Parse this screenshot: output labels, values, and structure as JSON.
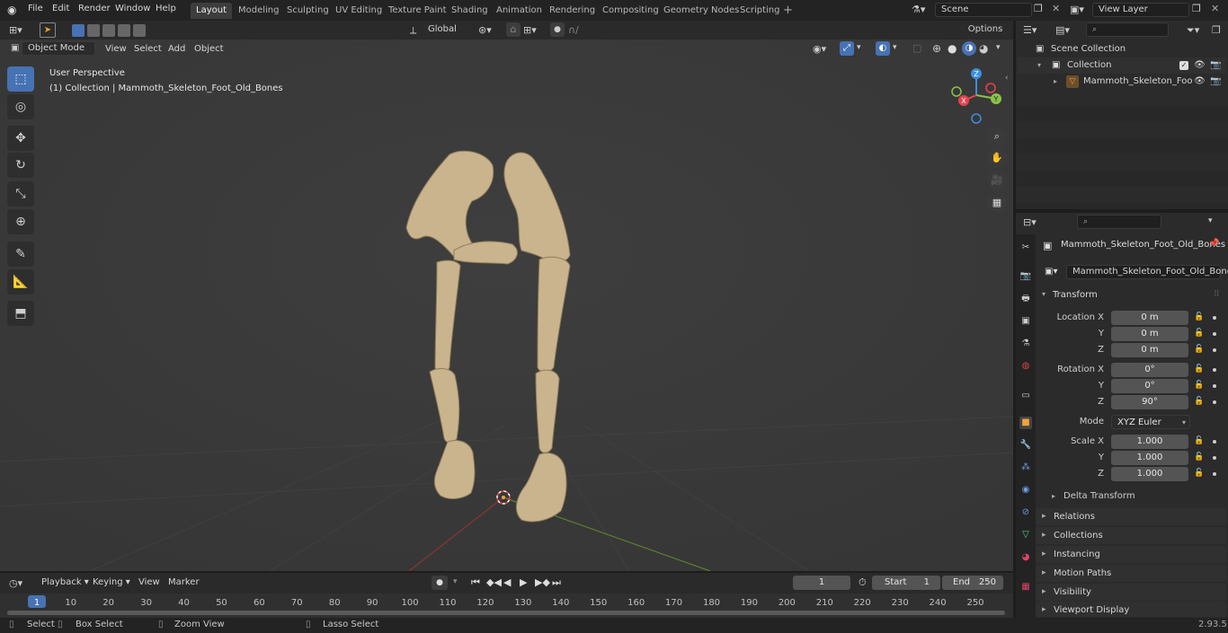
{
  "topbar": {
    "menus": [
      "File",
      "Edit",
      "Render",
      "Window",
      "Help"
    ],
    "workspaces": [
      "Layout",
      "Modeling",
      "Sculpting",
      "UV Editing",
      "Texture Paint",
      "Shading",
      "Animation",
      "Rendering",
      "Compositing",
      "Geometry Nodes",
      "Scripting"
    ],
    "active_workspace": "Layout",
    "add_tab": "+",
    "scene_name": "Scene",
    "view_layer": "View Layer"
  },
  "viewport_header": {
    "mode": "Object Mode",
    "menus": [
      "View",
      "Select",
      "Add",
      "Object"
    ],
    "transform_orientation": "Global",
    "options": "Options"
  },
  "viewport": {
    "perspective": "User Perspective",
    "collection_info": "(1) Collection | Mammoth_Skeleton_Foot_Old_Bones",
    "gizmo_axes": {
      "x": "X",
      "y": "Y",
      "z": "Z"
    }
  },
  "outliner": {
    "root": "Scene Collection",
    "collection": "Collection",
    "object": "Mammoth_Skeleton_Foo"
  },
  "properties": {
    "object_name": "Mammoth_Skeleton_Foot_Old_Bones",
    "object_field": "Mammoth_Skeleton_Foot_Old_Bones",
    "transform_title": "Transform",
    "location_label": "Location X",
    "y_label": "Y",
    "z_label": "Z",
    "location": [
      "0 m",
      "0 m",
      "0 m"
    ],
    "rotation_label": "Rotation X",
    "rotation": [
      "0°",
      "0°",
      "90°"
    ],
    "mode_label": "Mode",
    "mode_value": "XYZ Euler",
    "scale_label": "Scale X",
    "scale": [
      "1.000",
      "1.000",
      "1.000"
    ],
    "delta_transform": "Delta Transform",
    "sections": [
      "Relations",
      "Collections",
      "Instancing",
      "Motion Paths",
      "Visibility",
      "Viewport Display"
    ]
  },
  "timeline": {
    "menus": [
      "Playback",
      "Keying",
      "View",
      "Marker"
    ],
    "current_frame": "1",
    "start_label": "Start",
    "start_value": "1",
    "end_label": "End",
    "end_value": "250",
    "ruler": [
      "1",
      "10",
      "20",
      "30",
      "40",
      "50",
      "60",
      "70",
      "80",
      "90",
      "100",
      "110",
      "120",
      "130",
      "140",
      "150",
      "160",
      "170",
      "180",
      "190",
      "200",
      "210",
      "220",
      "230",
      "240",
      "250"
    ]
  },
  "statusbar": {
    "select": "Select",
    "box_select": "Box Select",
    "zoom_view": "Zoom View",
    "lasso_select": "Lasso Select",
    "version": "2.93.5"
  },
  "colors": {
    "accent": "#4772b3",
    "x_axis": "#e8424f",
    "y_axis": "#8bc34a",
    "z_axis": "#3d8ee0"
  }
}
